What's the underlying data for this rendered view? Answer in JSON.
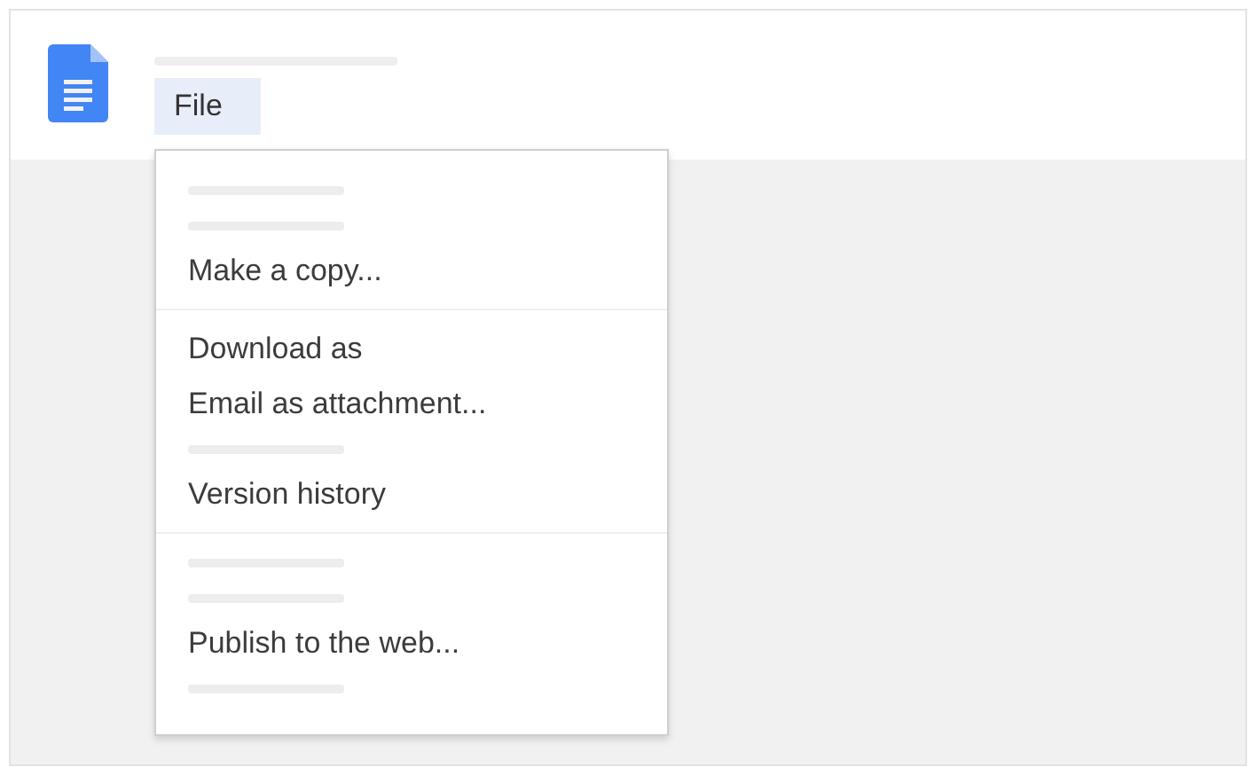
{
  "menu_bar": {
    "items": [
      {
        "label": "File",
        "selected": true
      }
    ]
  },
  "file_menu": {
    "items": [
      {
        "kind": "skeleton"
      },
      {
        "kind": "skeleton"
      },
      {
        "kind": "item",
        "label": "Make a copy..."
      },
      {
        "kind": "divider"
      },
      {
        "kind": "item",
        "label": "Download as"
      },
      {
        "kind": "item",
        "label": "Email as attachment..."
      },
      {
        "kind": "skeleton"
      },
      {
        "kind": "item",
        "label": "Version history"
      },
      {
        "kind": "divider"
      },
      {
        "kind": "skeleton"
      },
      {
        "kind": "skeleton"
      },
      {
        "kind": "item",
        "label": "Publish to the web..."
      },
      {
        "kind": "skeleton"
      }
    ]
  }
}
